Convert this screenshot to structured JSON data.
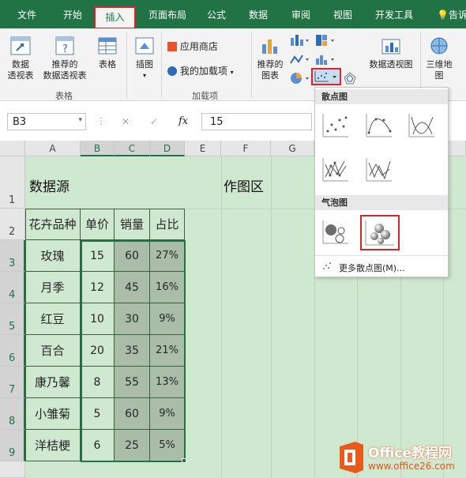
{
  "ribbon_tabs": [
    "文件",
    "开始",
    "插入",
    "页面布局",
    "公式",
    "数据",
    "审阅",
    "视图",
    "开发工具"
  ],
  "active_tab": "插入",
  "tell_me": "告诉",
  "ribbon": {
    "tables_group": {
      "pivot": "数据\n透视表",
      "recommended_pivot": "推荐的\n数据透视表",
      "table": "表格",
      "label": "表格"
    },
    "illustrations": {
      "label": "插图"
    },
    "addins": {
      "store": "应用商店",
      "my_addins": "我的加载项",
      "label": "加载项"
    },
    "charts": {
      "recommended": "推荐的\n图表",
      "pivot_chart": "数据透视图"
    },
    "map3d": {
      "label": "三维地\n图"
    }
  },
  "formula_bar": {
    "name_box": "B3",
    "cancel": "✕",
    "enter": "✓",
    "fx": "fx",
    "value": "15"
  },
  "columns": [
    "A",
    "B",
    "C",
    "D",
    "E",
    "F",
    "G"
  ],
  "rows": [
    "1",
    "2",
    "3",
    "4",
    "5",
    "6",
    "7",
    "8",
    "9"
  ],
  "sheet": {
    "title_data": "数据源",
    "title_chart": "作图区",
    "headers": [
      "花卉品种",
      "单价",
      "销量",
      "占比"
    ],
    "records": [
      [
        "玫瑰",
        "15",
        "60",
        "27%"
      ],
      [
        "月季",
        "12",
        "45",
        "16%"
      ],
      [
        "红豆",
        "10",
        "30",
        "9%"
      ],
      [
        "百合",
        "20",
        "35",
        "21%"
      ],
      [
        "康乃馨",
        "8",
        "55",
        "13%"
      ],
      [
        "小雏菊",
        "5",
        "60",
        "9%"
      ],
      [
        "洋桔梗",
        "6",
        "25",
        "5%"
      ]
    ]
  },
  "dropdown": {
    "scatter_header": "散点图",
    "bubble_header": "气泡图",
    "more": "更多散点图(M)..."
  },
  "watermark": {
    "brand": "Office教程网",
    "url": "www.office26.com"
  },
  "colors": {
    "excel_green": "#217346",
    "highlight_red": "#d9252a",
    "selection_fill": "#a9bda8"
  }
}
